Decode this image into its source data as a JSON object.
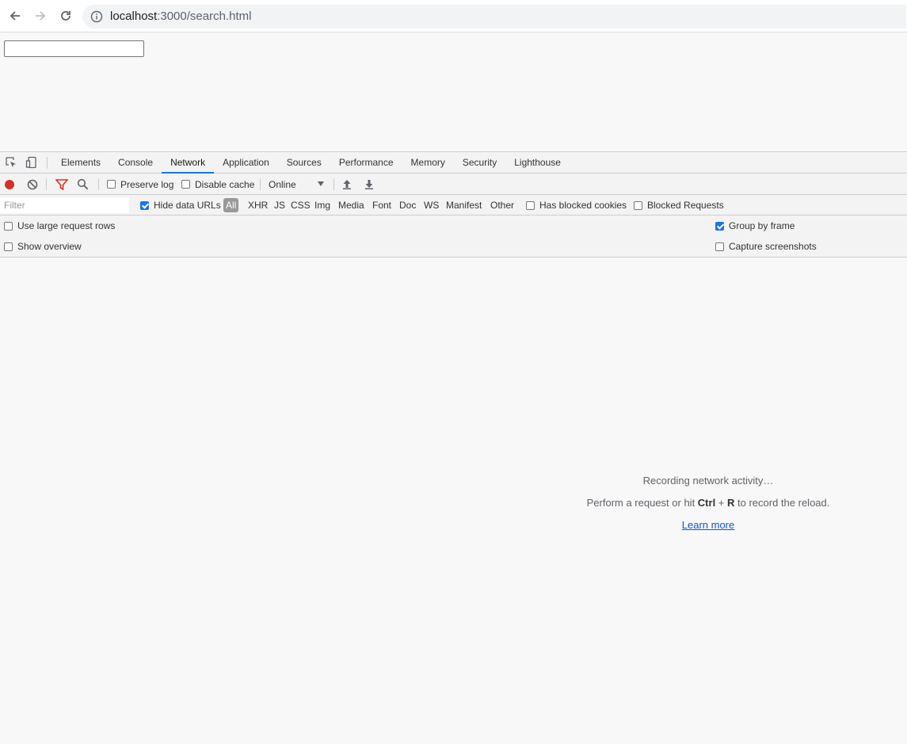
{
  "browser": {
    "url_host": "localhost",
    "url_path": ":3000/search.html"
  },
  "devtools": {
    "tabs": [
      {
        "label": "Elements"
      },
      {
        "label": "Console"
      },
      {
        "label": "Network"
      },
      {
        "label": "Application"
      },
      {
        "label": "Sources"
      },
      {
        "label": "Performance"
      },
      {
        "label": "Memory"
      },
      {
        "label": "Security"
      },
      {
        "label": "Lighthouse"
      }
    ],
    "active_tab": "Network",
    "toolbar": {
      "preserve_log": "Preserve log",
      "disable_cache": "Disable cache",
      "throttling": "Online"
    },
    "filterbar": {
      "filter_placeholder": "Filter",
      "hide_data_urls": "Hide data URLs",
      "types": [
        "All",
        "XHR",
        "JS",
        "CSS",
        "Img",
        "Media",
        "Font",
        "Doc",
        "WS",
        "Manifest",
        "Other"
      ],
      "has_blocked_cookies": "Has blocked cookies",
      "blocked_requests": "Blocked Requests"
    },
    "options": {
      "use_large_rows": "Use large request rows",
      "show_overview": "Show overview",
      "group_by_frame": "Group by frame",
      "capture_screenshots": "Capture screenshots"
    },
    "empty": {
      "recording": "Recording network activity…",
      "perform_prefix": "Perform a request or hit ",
      "key_ctrl": "Ctrl",
      "plus": " + ",
      "key_r": "R",
      "perform_suffix": " to record the reload.",
      "learn_more": "Learn more"
    }
  },
  "colors": {
    "accent": "#1a73e8",
    "record_red": "#d93025",
    "filter_red": "#d93025"
  }
}
